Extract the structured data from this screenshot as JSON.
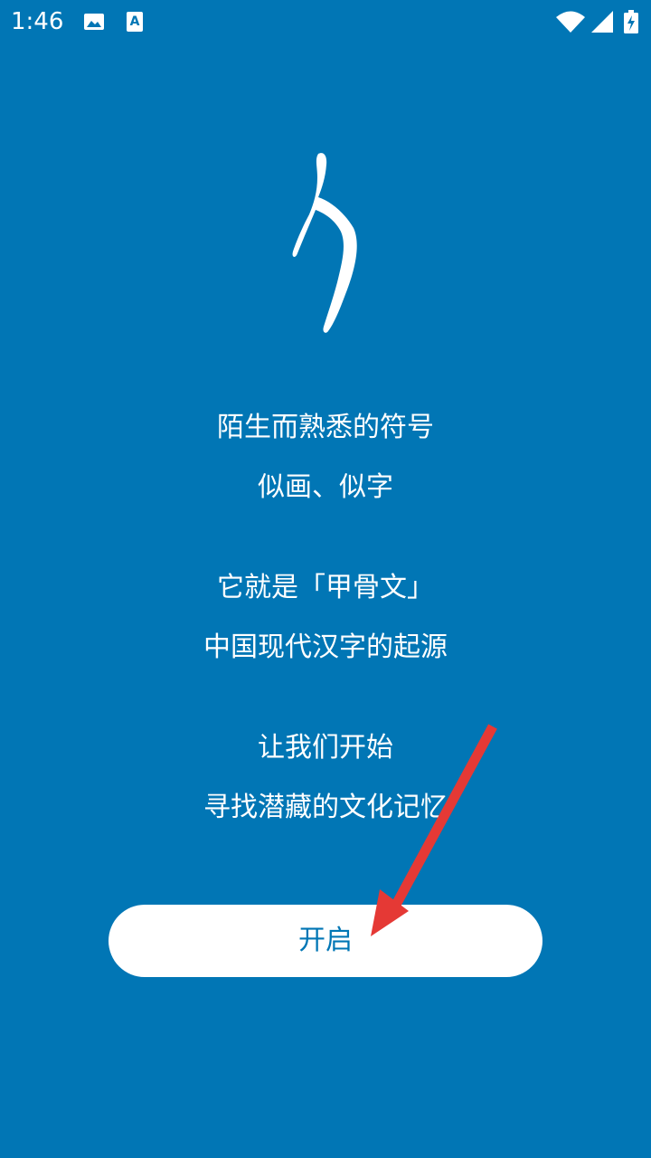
{
  "status_bar": {
    "time": "1:46"
  },
  "intro": {
    "line1": "陌生而熟悉的符号",
    "line2": "似画、似字",
    "line3": "它就是「甲骨文」",
    "line4": "中国现代汉字的起源",
    "line5": "让我们开始",
    "line6": "寻找潜藏的文化记忆"
  },
  "start_button": {
    "label": "开启"
  },
  "colors": {
    "background": "#0176b5",
    "button_background": "#ffffff",
    "button_text": "#0176b5",
    "annotation_arrow": "#e53935"
  },
  "icons": {
    "status_image": "image-icon",
    "status_a": "text-a-icon",
    "wifi": "wifi-icon",
    "signal": "signal-icon",
    "battery": "battery-charging-icon",
    "glyph": "oracle-bone-glyph-icon",
    "arrow": "red-arrow-icon"
  }
}
